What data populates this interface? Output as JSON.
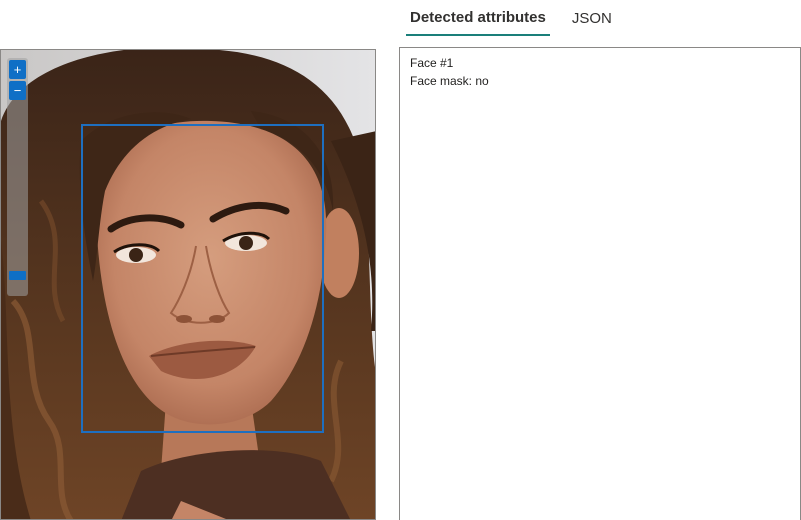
{
  "tabs": [
    {
      "label": "Detected attributes",
      "active": true
    },
    {
      "label": "JSON",
      "active": false
    }
  ],
  "image": {
    "subject": "portrait photo of a woman with curly brown hair",
    "face_box_color": "#1e6fc0"
  },
  "zoom": {
    "zoom_in_icon": "plus-icon",
    "zoom_out_icon": "minus-icon",
    "level": 0.1
  },
  "attributes": {
    "lines": [
      "Face #1",
      "Face mask: no"
    ]
  }
}
